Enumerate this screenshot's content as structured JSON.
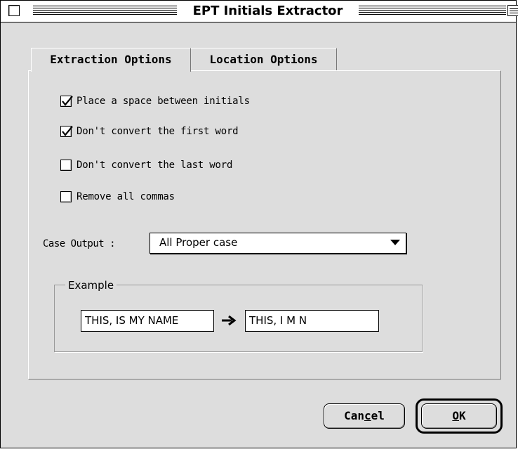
{
  "window": {
    "title": "EPT Initials Extractor"
  },
  "tabs": [
    {
      "label": "Extraction Options",
      "active": true
    },
    {
      "label": "Location Options",
      "active": false
    }
  ],
  "options": [
    {
      "label": "Place a space between initials",
      "checked": true
    },
    {
      "label": "Don't convert the first word",
      "checked": true
    },
    {
      "label": "Don't convert the last word",
      "checked": false
    },
    {
      "label": "Remove all commas",
      "checked": false
    }
  ],
  "case_output": {
    "label": "Case Output :",
    "selected": "All Proper case"
  },
  "example": {
    "title": "Example",
    "input": "THIS, IS MY NAME",
    "output": "THIS, I M N"
  },
  "buttons": {
    "cancel_pre": "Can",
    "cancel_mnemonic": "c",
    "cancel_post": "el",
    "ok_mnemonic": "O",
    "ok_post": "K"
  },
  "icons": {
    "check": "checkmark-icon",
    "dropdown": "triangle-down-icon",
    "arrow": "arrow-right-icon"
  },
  "colors": {
    "window_bg": "#dddddd",
    "field_bg": "#ffffff"
  }
}
